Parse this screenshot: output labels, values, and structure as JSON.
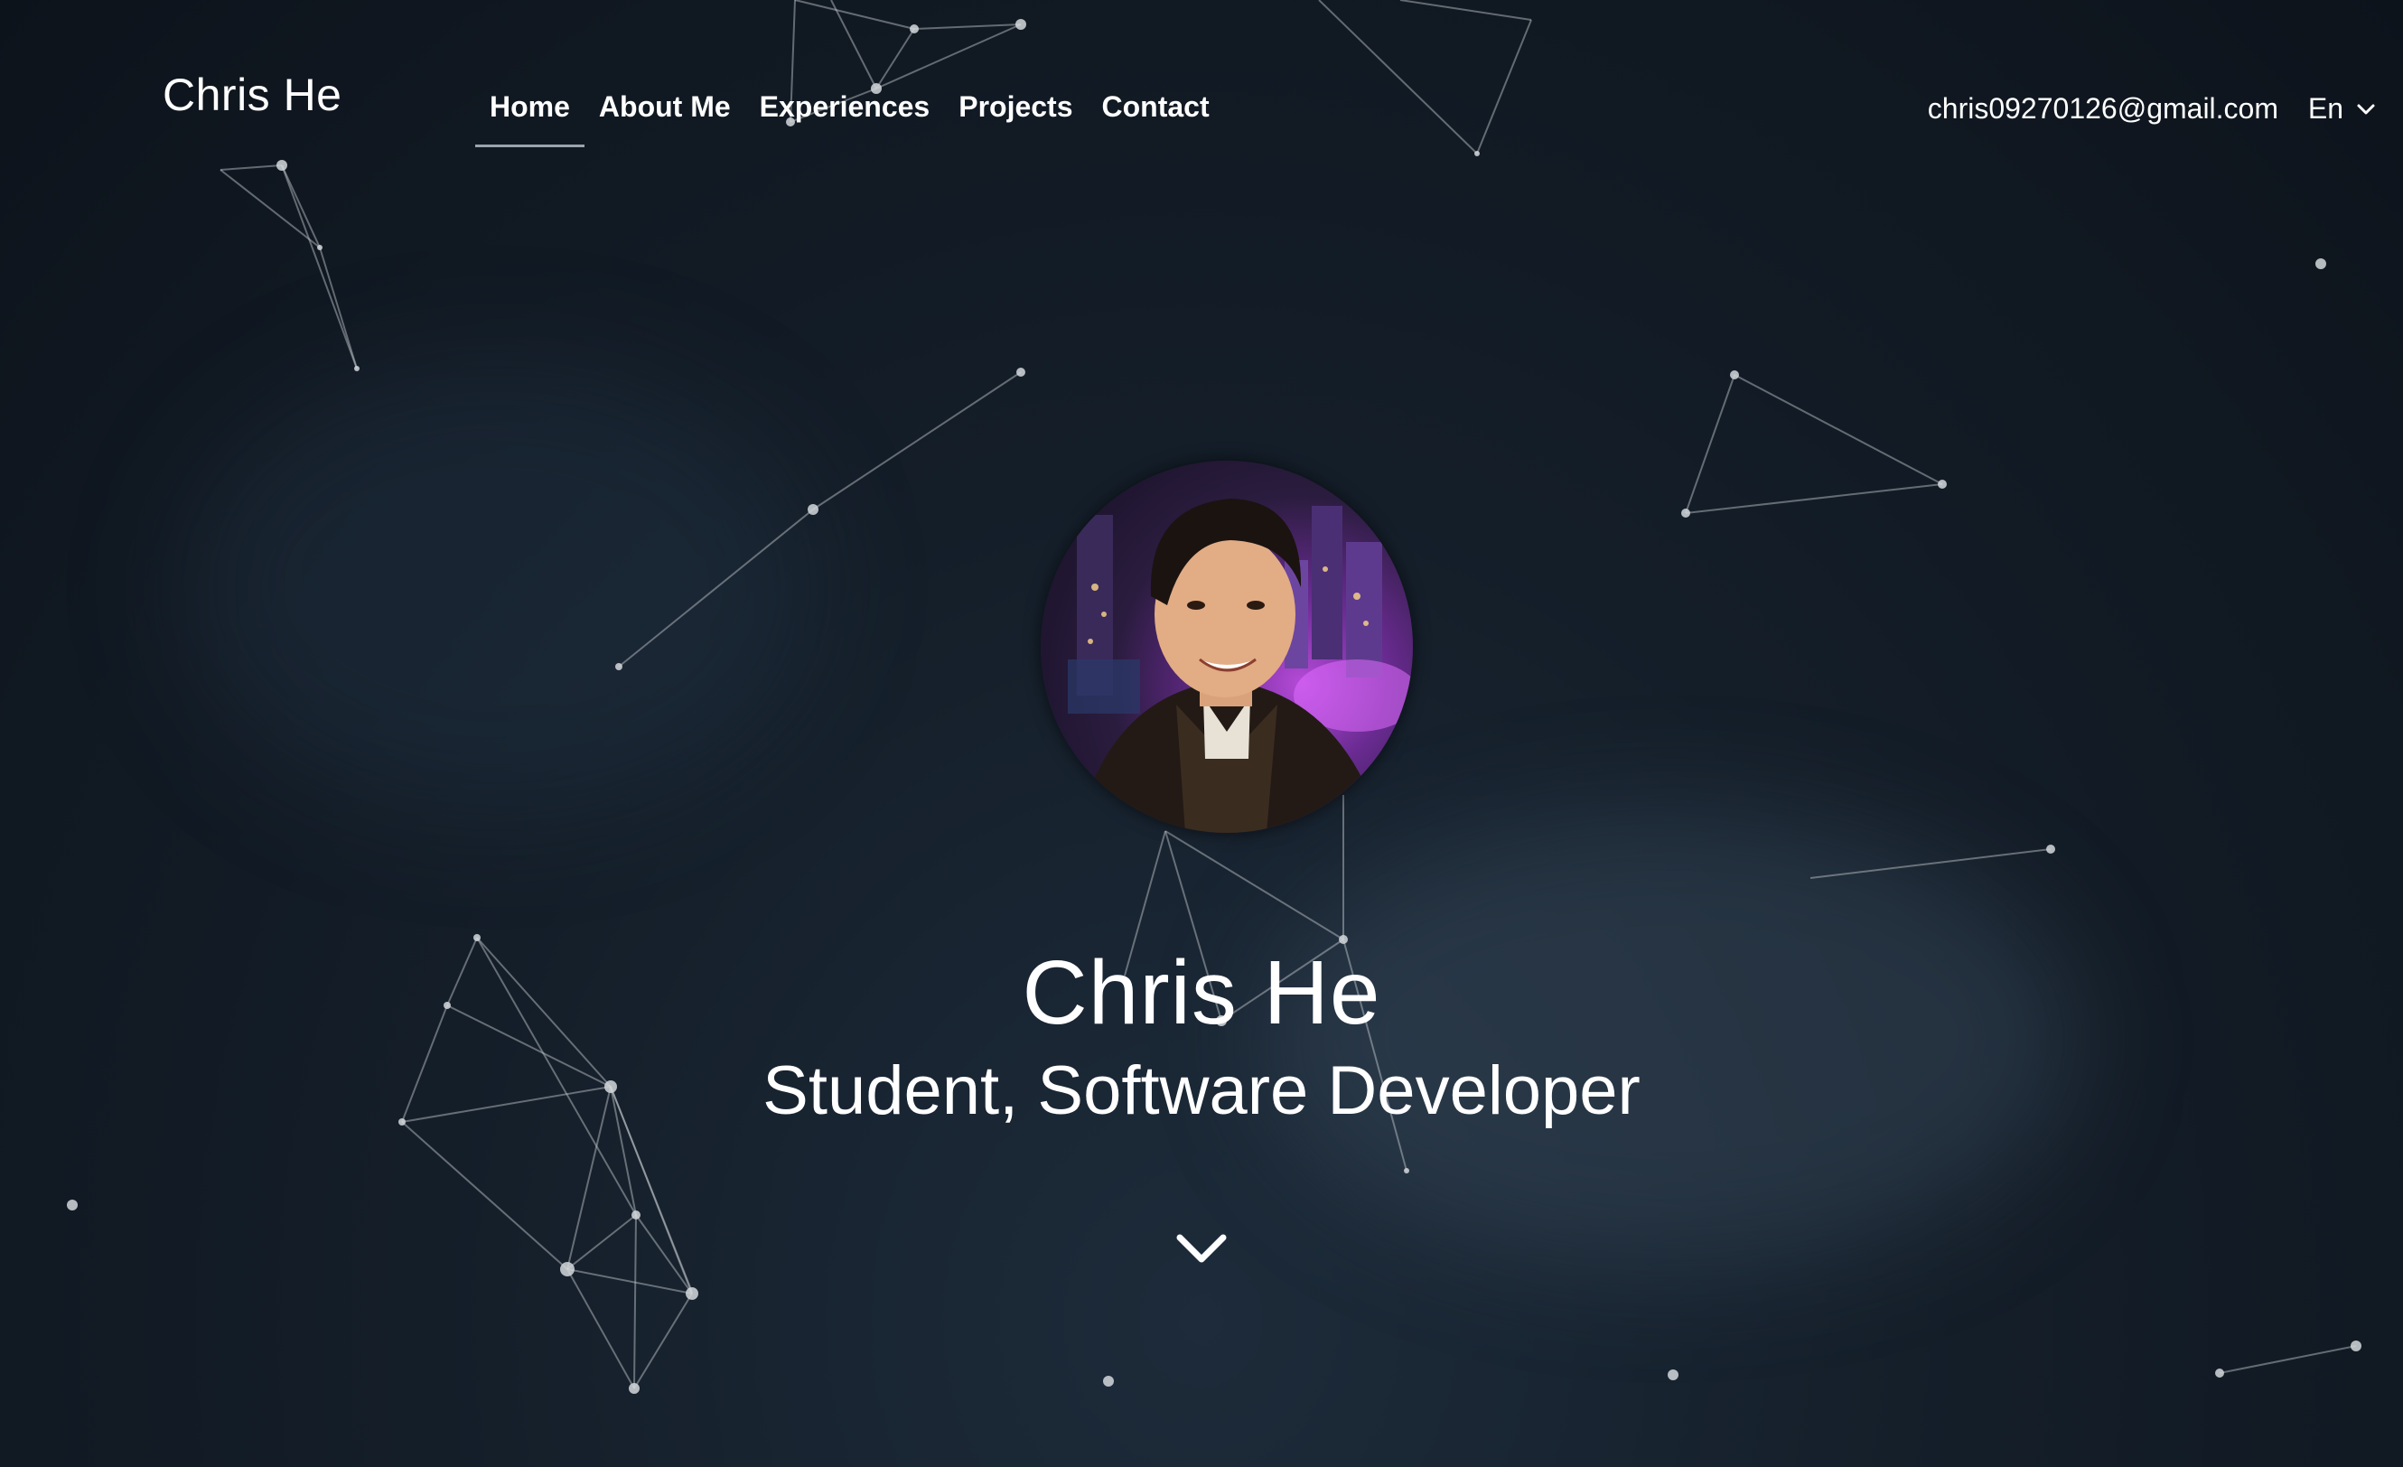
{
  "header": {
    "brand": "Chris He",
    "nav": [
      {
        "label": "Home",
        "active": true
      },
      {
        "label": "About Me"
      },
      {
        "label": "Experiences"
      },
      {
        "label": "Projects"
      },
      {
        "label": "Contact"
      }
    ],
    "email": "chris09270126@gmail.com",
    "language": "En"
  },
  "hero": {
    "name": "Chris He",
    "subtitle": "Student, Software Developer",
    "avatar_alt": "Profile photo"
  },
  "icons": {
    "language_dropdown": "chevron-down-icon",
    "scroll_down": "chevron-down-icon"
  },
  "colors": {
    "background": "#121a24",
    "text": "#ffffff",
    "nav_underline": "#9aa4ad",
    "network_line": "#c9ced3"
  }
}
